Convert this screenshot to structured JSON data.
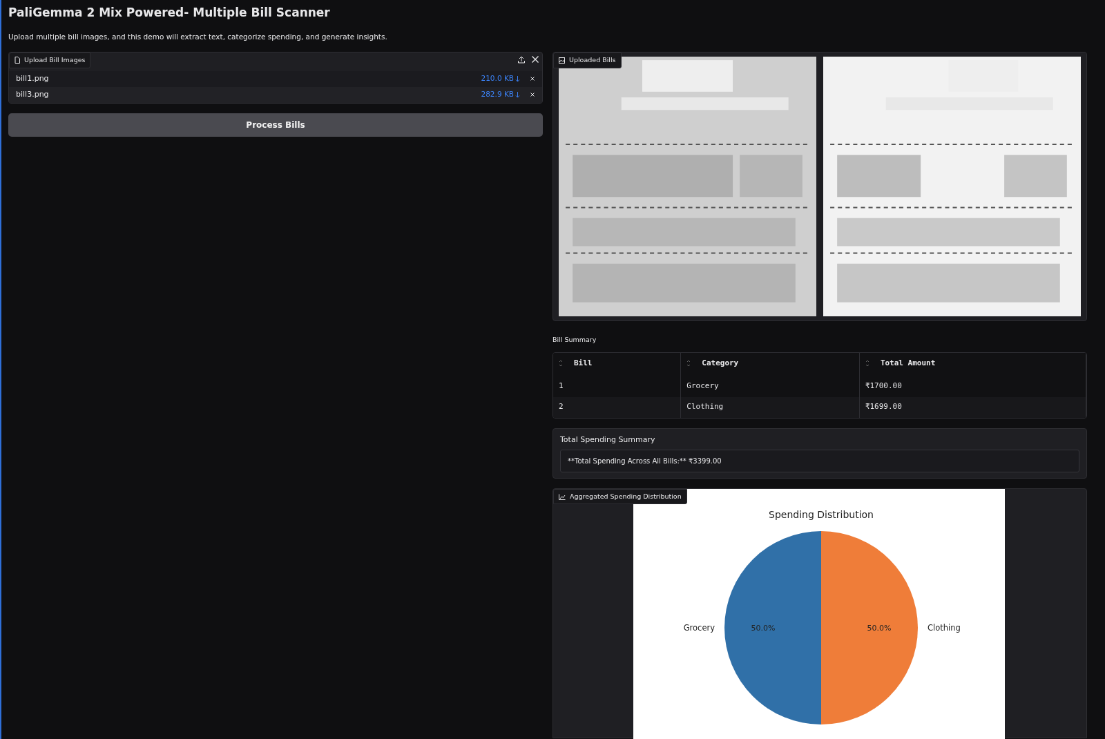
{
  "title": "PaliGemma 2 Mix Powered- Multiple Bill Scanner",
  "description": "Upload multiple bill images, and this demo will extract text, categorize spending, and generate insights.",
  "upload": {
    "label": "Upload Bill Images",
    "files": [
      {
        "name": "bill1.png",
        "size": "210.0 KB"
      },
      {
        "name": "bill3.png",
        "size": "282.9 KB"
      }
    ]
  },
  "process_button": "Process Bills",
  "gallery": {
    "label": "Uploaded Bills"
  },
  "summary_table": {
    "label": "Bill Summary",
    "columns": [
      "Bill",
      "Category",
      "Total Amount"
    ],
    "rows": [
      [
        "1",
        "Grocery",
        "₹1700.00"
      ],
      [
        "2",
        "Clothing",
        "₹1699.00"
      ]
    ]
  },
  "total_summary": {
    "label": "Total Spending Summary",
    "text": "**Total Spending Across All Bills:** ₹3399.00"
  },
  "plot": {
    "label": "Aggregated Spending Distribution",
    "chart_data": {
      "type": "pie",
      "title": "Spending Distribution",
      "categories": [
        "Grocery",
        "Clothing"
      ],
      "values": [
        50,
        50
      ],
      "colors": [
        "#3070a8",
        "#ef7d39"
      ],
      "value_labels": [
        "50.0%",
        "50.0%"
      ]
    }
  }
}
